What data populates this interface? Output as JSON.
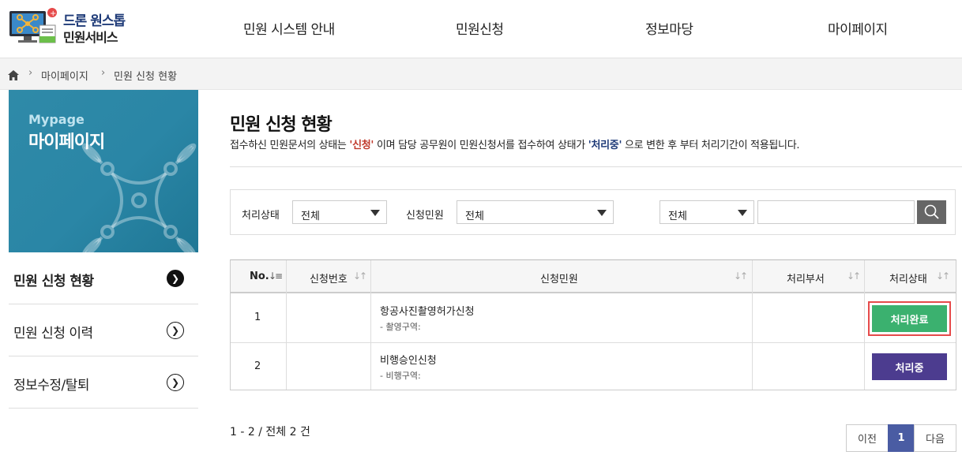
{
  "logo": {
    "line1": "드론 원스톱",
    "line2": "민원서비스"
  },
  "nav": [
    "민원 시스템 안내",
    "민원신청",
    "정보마당",
    "마이페이지"
  ],
  "breadcrumb": [
    "마이페이지",
    "민원 신청 현황"
  ],
  "sidebar": {
    "en": "Mypage",
    "ko": "마이페이지",
    "items": [
      {
        "label": "민원 신청 현황",
        "active": true
      },
      {
        "label": "민원 신청 이력",
        "active": false
      },
      {
        "label": "정보수정/탈퇴",
        "active": false
      }
    ]
  },
  "page": {
    "title": "민원 신청 현황",
    "desc_1": "접수하신 민원문서의 상태는 ",
    "desc_hl1": "'신청'",
    "desc_2": " 이며 담당 공무원이 민원신청서를 접수하여 상태가 ",
    "desc_hl2": "'처리중'",
    "desc_3": " 으로 변한 후 부터 처리기간이 적용됩니다."
  },
  "filter": {
    "status_label": "처리상태",
    "status_value": "전체",
    "type_label": "신청민원",
    "type_value": "전체",
    "search_scope": "전체",
    "search_value": ""
  },
  "table": {
    "headers": [
      "No.",
      "신청번호",
      "신청민원",
      "처리부서",
      "처리상태"
    ],
    "rows": [
      {
        "no": "1",
        "number": "",
        "title": "항공사진촬영허가신청",
        "sub": "- 촬영구역:",
        "dept": "",
        "status": "처리완료"
      },
      {
        "no": "2",
        "number": "",
        "title": "비행승인신청",
        "sub": "- 비행구역:",
        "dept": "",
        "status": "처리중"
      }
    ]
  },
  "summary": "1 - 2 / 전체 2 건",
  "pagination": {
    "prev": "이전",
    "current": "1",
    "next": "다음"
  },
  "colors": {
    "brand": "#1f3b78",
    "done": "#3bb16f",
    "processing": "#4c3c8f",
    "page_current": "#4a5ca3",
    "highlight_red": "#c0392b"
  }
}
